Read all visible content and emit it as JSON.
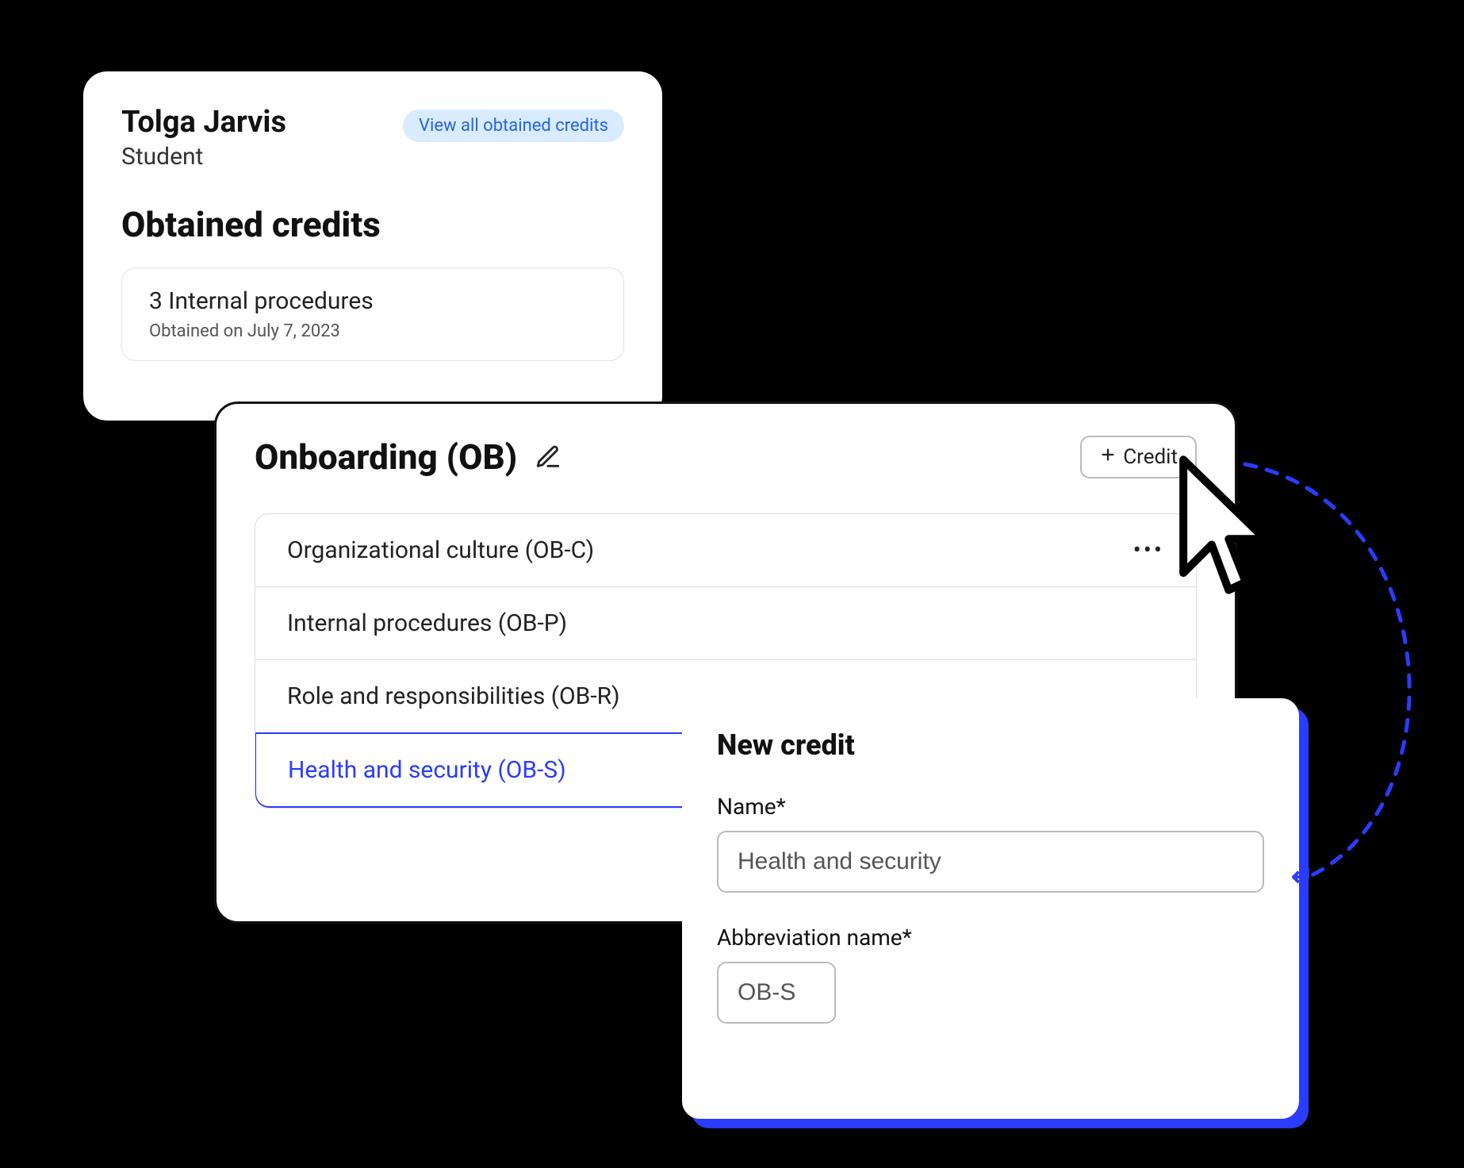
{
  "profile": {
    "name": "Tolga Jarvis",
    "role": "Student",
    "view_all_link": "View all obtained credits",
    "section_title": "Obtained credits",
    "credit": {
      "title": "3 Internal procedures",
      "obtained": "Obtained on July 7, 2023"
    }
  },
  "onboarding": {
    "title": "Onboarding (OB)",
    "add_button": "Credit",
    "rows": [
      {
        "label": "Organizational culture (OB-C)",
        "selected": false,
        "menu": true
      },
      {
        "label": "Internal procedures (OB-P)",
        "selected": false,
        "menu": false
      },
      {
        "label": "Role and responsibilities (OB-R)",
        "selected": false,
        "menu": false
      },
      {
        "label": "Health and security (OB-S)",
        "selected": true,
        "menu": false
      }
    ]
  },
  "new_credit": {
    "title": "New credit",
    "name_label": "Name*",
    "name_value": "Health and security",
    "abbrev_label": "Abbreviation name*",
    "abbrev_value": "OB-S"
  },
  "colors": {
    "accent": "#2a3cff",
    "link_bg": "#d9ecff",
    "link_fg": "#2463eb"
  }
}
